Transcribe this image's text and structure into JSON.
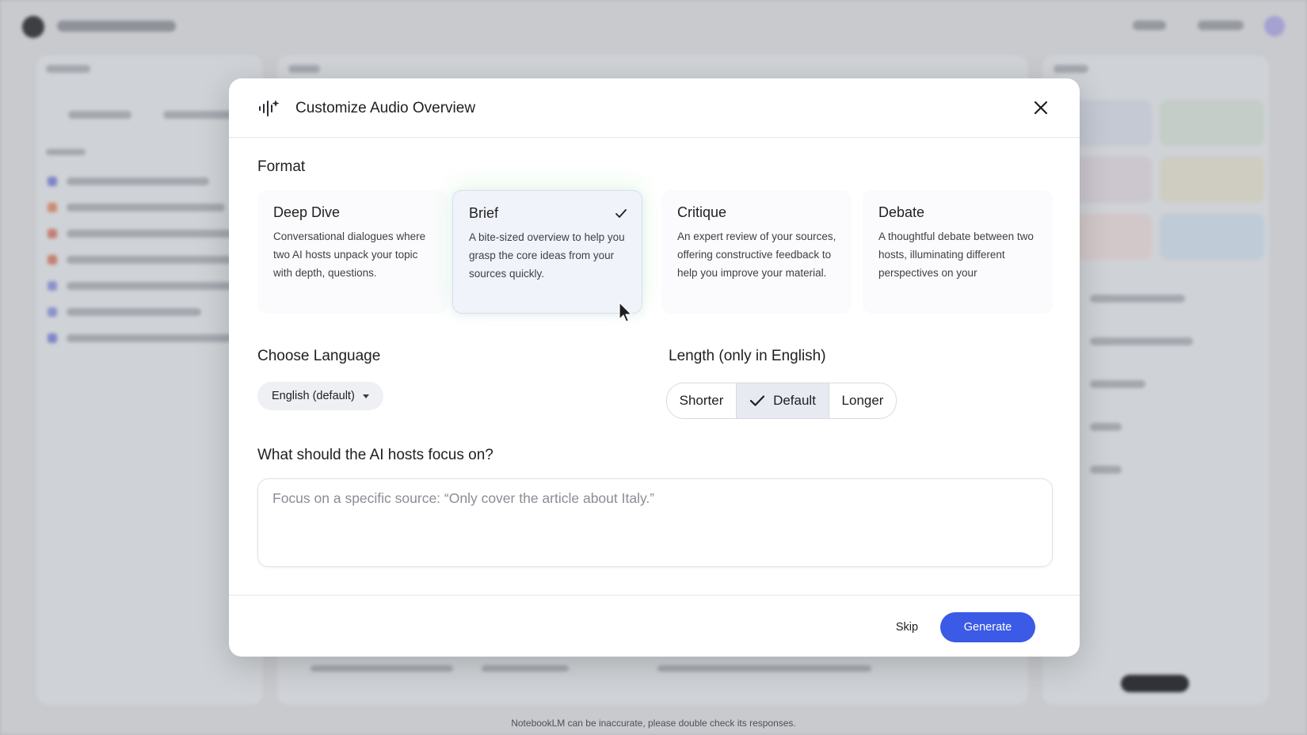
{
  "dialog": {
    "title": "Customize Audio Overview",
    "icon": "audio-sparkle-icon"
  },
  "format": {
    "label": "Format",
    "selected": "Brief",
    "options": [
      {
        "title": "Deep Dive",
        "description": "Conversational dialogues where two AI hosts unpack your topic with depth, questions."
      },
      {
        "title": "Brief",
        "description": "A bite-sized overview to help you grasp the core ideas from your sources quickly."
      },
      {
        "title": "Critique",
        "description": "An expert review of your sources, offering constructive feedback to help you improve your material."
      },
      {
        "title": "Debate",
        "description": "A thoughtful debate between two hosts, illuminating different perspectives on your"
      }
    ]
  },
  "language": {
    "label": "Choose Language",
    "selected": "English (default)"
  },
  "length": {
    "label": "Length (only in English)",
    "options": [
      "Shorter",
      "Default",
      "Longer"
    ],
    "selected": "Default"
  },
  "focus": {
    "label": "What should the AI hosts focus on?",
    "placeholder": "Focus on a specific source: “Only cover the article about Italy.”",
    "value": ""
  },
  "footer": {
    "skip_label": "Skip",
    "generate_label": "Generate"
  },
  "background": {
    "disclaimer": "NotebookLM can be inaccurate, please double check its responses."
  },
  "colors": {
    "accent": "#3b5ae6",
    "selected_card": "#f1f3fa"
  }
}
